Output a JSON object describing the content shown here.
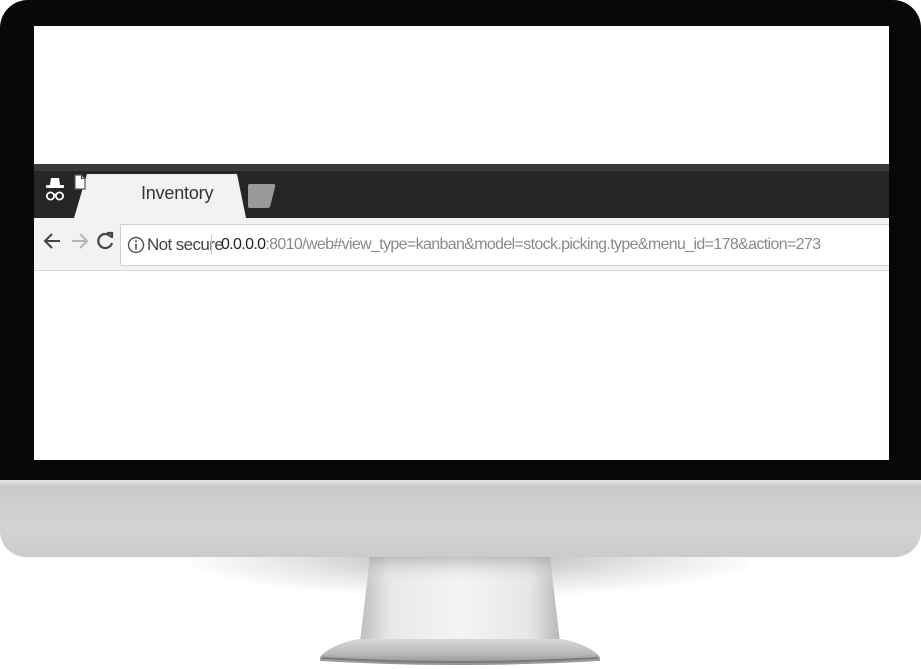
{
  "browser": {
    "tabs": [
      {
        "title": "Inventory",
        "close_label": "×",
        "icon": "page-icon",
        "active": true
      }
    ],
    "incognito_icon": "incognito-icon",
    "new_tab_icon": "new-tab-icon",
    "toolbar": {
      "back_icon": "back-arrow-icon",
      "forward_icon": "forward-arrow-icon",
      "reload_icon": "reload-icon"
    },
    "omnibox": {
      "security_icon": "info-icon",
      "security_label": "Not secure",
      "url_host": "0.0.0.0",
      "url_rest": ":8010/web#view_type=kanban&model=stock.picking.type&menu_id=178&action=273"
    }
  },
  "colors": {
    "bezel": "#080808",
    "tab_strip": "#262626",
    "active_tab": "#f2f2f2",
    "toolbar": "#f2f2f2",
    "chin": "#d3d3d3"
  }
}
